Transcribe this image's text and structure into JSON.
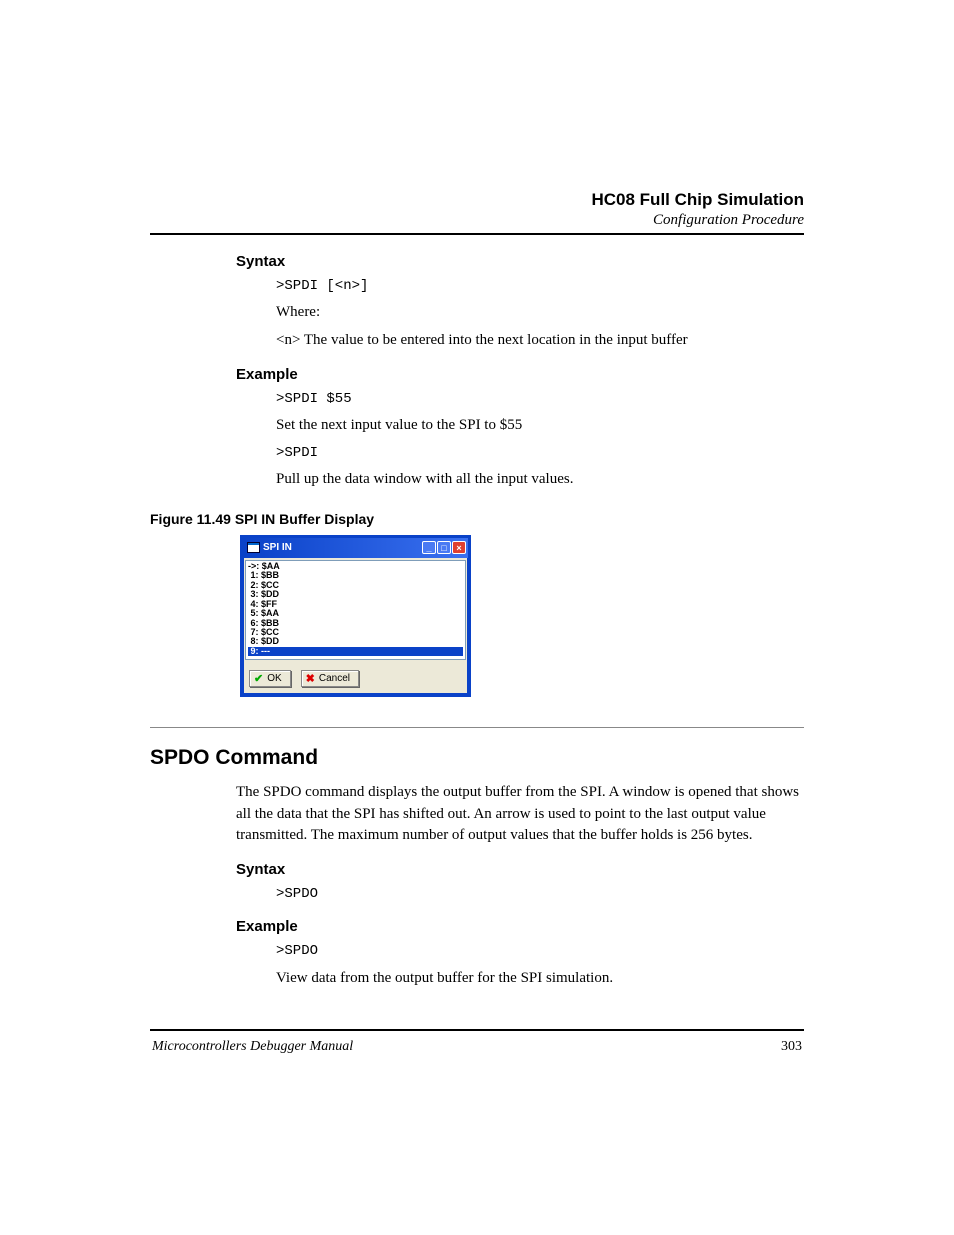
{
  "header": {
    "title": "HC08 Full Chip Simulation",
    "subtitle": "Configuration Procedure"
  },
  "spdi": {
    "syntax_heading": "Syntax",
    "syntax_cmd": ">SPDI [<n>]",
    "where_label": "Where:",
    "where_desc": "<n> The value to be entered into the next location in the input buffer",
    "example_heading": "Example",
    "example_cmd1": ">SPDI $55",
    "example_desc1": "Set the next input value to the SPI to $55",
    "example_cmd2": ">SPDI",
    "example_desc2": "Pull up the data window with all the input values."
  },
  "figure": {
    "caption": "Figure 11.49  SPI IN Buffer Display",
    "window_title": "SPI IN",
    "rows": [
      "->: $AA",
      " 1: $BB",
      " 2: $CC",
      " 3: $DD",
      " 4: $FF",
      " 5: $AA",
      " 6: $BB",
      " 7: $CC",
      " 8: $DD"
    ],
    "selected_row": " 9: ---",
    "ok_label": "OK",
    "cancel_label": "Cancel"
  },
  "spdo": {
    "heading": "SPDO Command",
    "body": "The SPDO command displays the output buffer from the SPI. A window is opened that shows all the data that the SPI has shifted out. An arrow is used to point to the last output value transmitted. The maximum number of output values that the buffer holds is 256 bytes.",
    "syntax_heading": "Syntax",
    "syntax_cmd": ">SPDO",
    "example_heading": "Example",
    "example_cmd": ">SPDO",
    "example_desc": "View data from the output buffer for the SPI simulation."
  },
  "footer": {
    "left": "Microcontrollers Debugger Manual",
    "right": "303"
  }
}
